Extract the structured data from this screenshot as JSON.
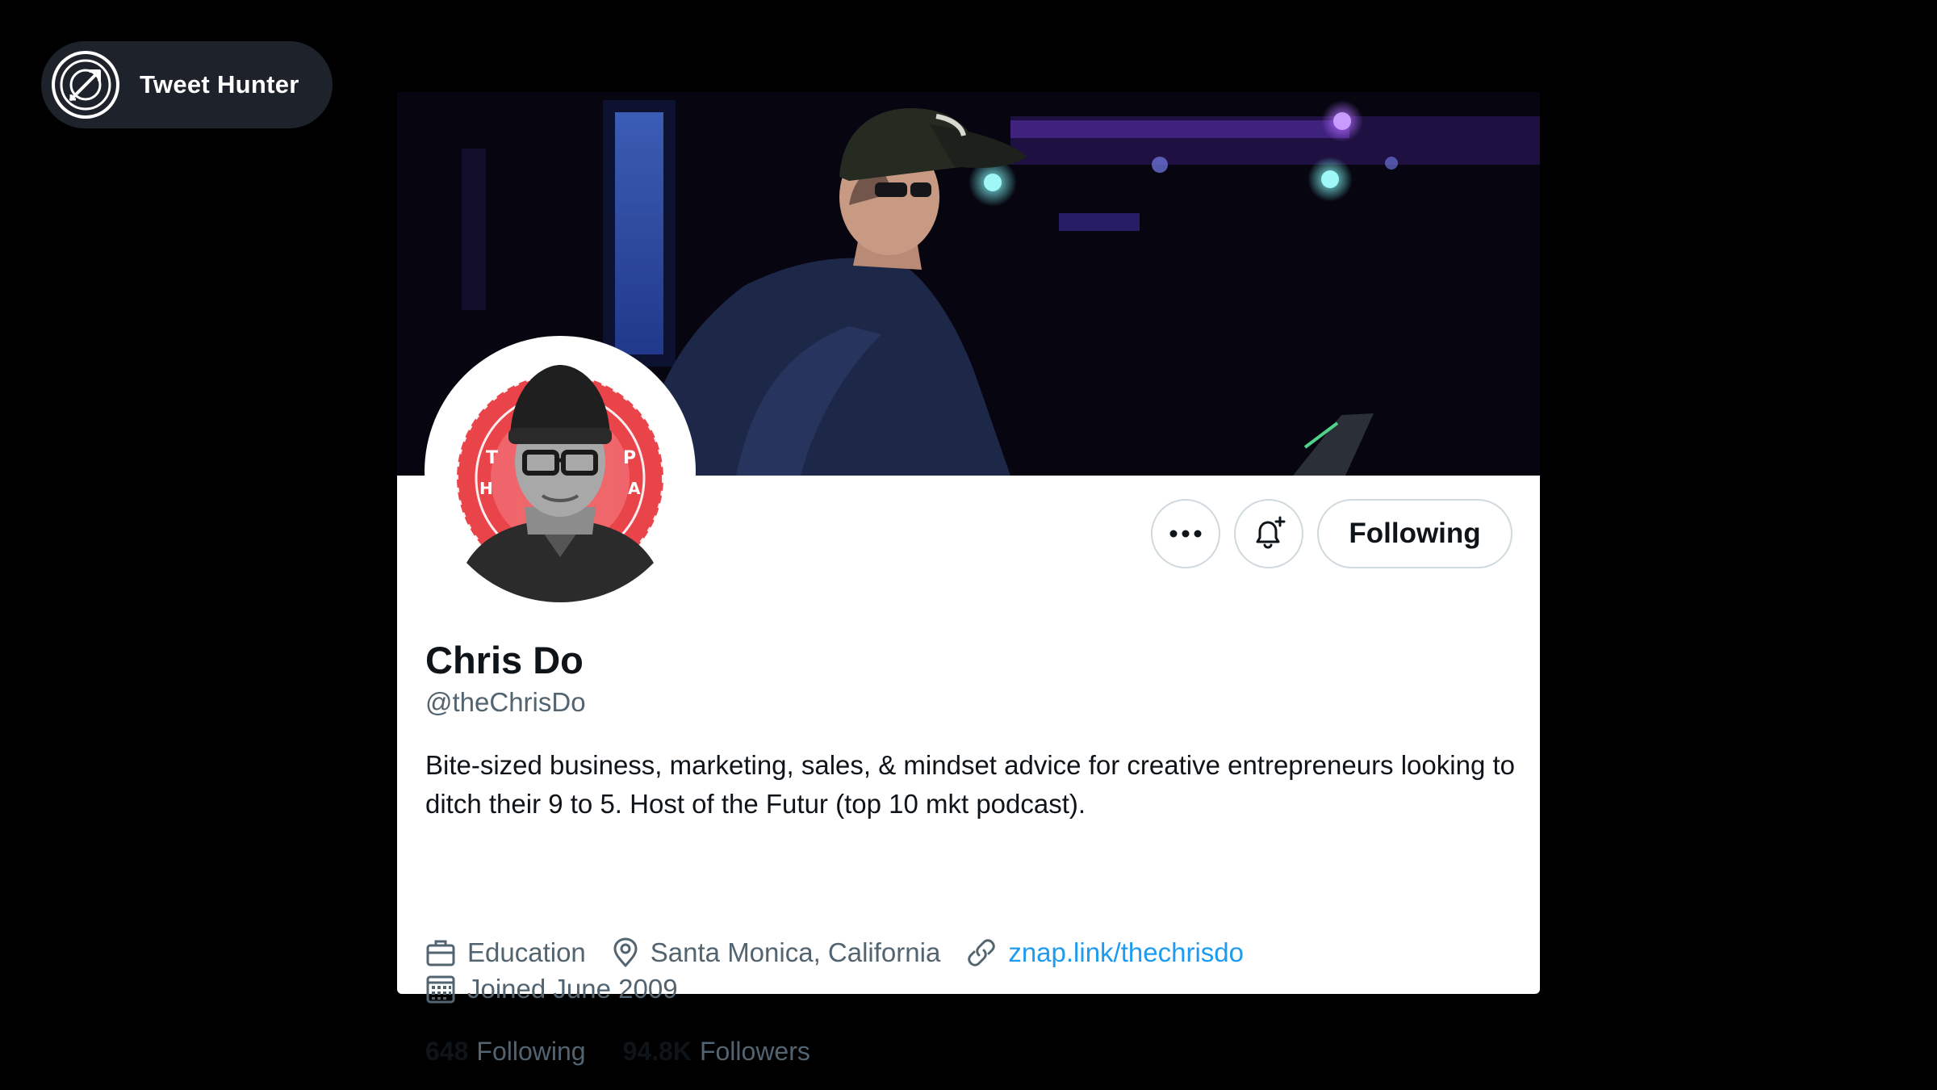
{
  "brand": {
    "name": "Tweet Hunter",
    "logo_icon": "crossed-arrow-target-icon"
  },
  "profile": {
    "display_name": "Chris Do",
    "handle": "@theChrisDo",
    "bio": "Bite-sized business, marketing, sales, & mindset advice for creative entrepreneurs looking to ditch their 9 to 5. Host of the Futur (top 10 mkt podcast).",
    "category": "Education",
    "location": "Santa Monica, California",
    "website": "znap.link/thechrisdo",
    "joined": "Joined June 2009",
    "following_count": "648",
    "following_label": "Following",
    "followers_count": "94.8K",
    "followers_label": "Followers"
  },
  "actions": {
    "more_icon": "more-dots-icon",
    "notify_icon": "bell-plus-icon",
    "following_button": "Following"
  },
  "colors": {
    "background": "#000000",
    "card": "#ffffff",
    "primary_text": "#0f1419",
    "secondary_text": "#536471",
    "link": "#1d9bf0",
    "border": "#cfd9de",
    "pill": "#1e232b",
    "avatar_badge": "#e8444a"
  }
}
